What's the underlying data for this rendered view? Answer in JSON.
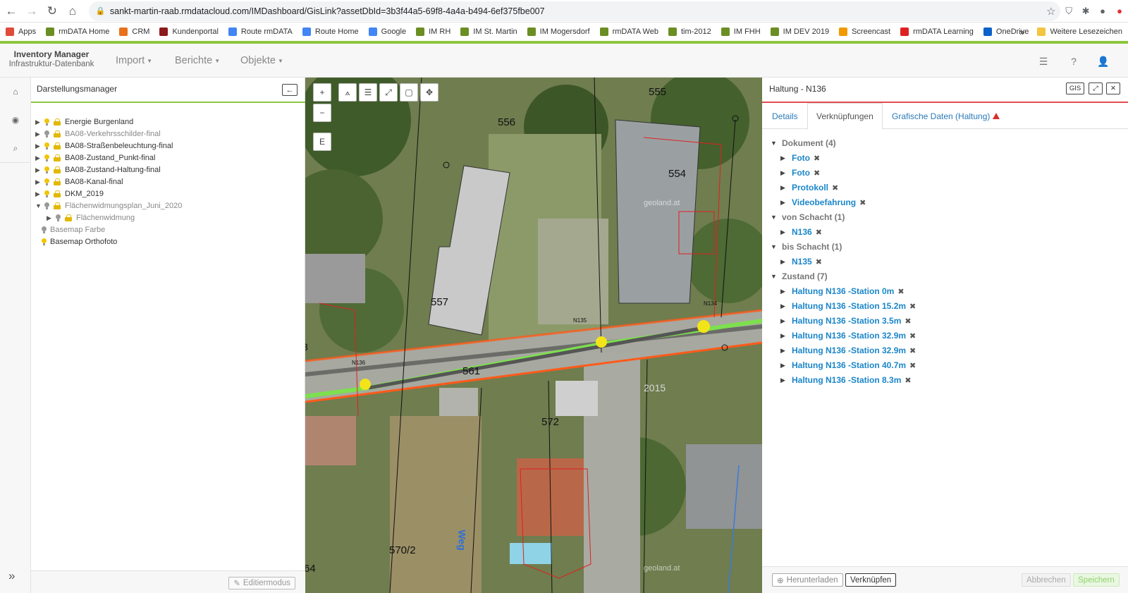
{
  "browser": {
    "url": "sankt-martin-raab.rmdatacloud.com/IMDashboard/GisLink?assetDbId=3b3f44a5-69f8-4a4a-b494-6ef375fbe007",
    "bookmarks": [
      {
        "label": "Apps",
        "color": "#e04b3a"
      },
      {
        "label": "rmDATA Home",
        "color": "#6b8e23"
      },
      {
        "label": "CRM",
        "color": "#e8711c"
      },
      {
        "label": "Kundenportal",
        "color": "#8b1a1a"
      },
      {
        "label": "Route rmDATA",
        "color": "#4285f4"
      },
      {
        "label": "Route Home",
        "color": "#4285f4"
      },
      {
        "label": "Google",
        "color": "#4285f4"
      },
      {
        "label": "IM RH",
        "color": "#6b8e23"
      },
      {
        "label": "IM St. Martin",
        "color": "#6b8e23"
      },
      {
        "label": "IM Mogersdorf",
        "color": "#6b8e23"
      },
      {
        "label": "rmDATA Web",
        "color": "#6b8e23"
      },
      {
        "label": "tim-2012",
        "color": "#6b8e23"
      },
      {
        "label": "IM FHH",
        "color": "#6b8e23"
      },
      {
        "label": "IM DEV 2019",
        "color": "#6b8e23"
      },
      {
        "label": "Screencast",
        "color": "#f29900"
      },
      {
        "label": "rmDATA Learning",
        "color": "#d22"
      },
      {
        "label": "OneDrive",
        "color": "#0b63c9"
      }
    ],
    "more_bookmarks": "»",
    "other_bookmarks": "Weitere Lesezeichen"
  },
  "app": {
    "brand_title": "Inventory Manager",
    "brand_subtitle": "Infrastruktur-Datenbank",
    "menu": [
      {
        "label": "Import"
      },
      {
        "label": "Berichte"
      },
      {
        "label": "Objekte"
      }
    ]
  },
  "layer_manager": {
    "title": "Darstellungsmanager",
    "layers": [
      {
        "label": "Energie Burgenland",
        "bulb": "on",
        "lock": true,
        "expand": "▶",
        "dim": false
      },
      {
        "label": "BA08-Verkehrsschilder-final",
        "bulb": "off",
        "lock": true,
        "expand": "▶",
        "dim": true
      },
      {
        "label": "BA08-Straßenbeleuchtung-final",
        "bulb": "on",
        "lock": true,
        "expand": "▶",
        "dim": false
      },
      {
        "label": "BA08-Zustand_Punkt-final",
        "bulb": "on",
        "lock": true,
        "expand": "▶",
        "dim": false
      },
      {
        "label": "BA08-Zustand-Haltung-final",
        "bulb": "on",
        "lock": true,
        "expand": "▶",
        "dim": false
      },
      {
        "label": "BA08-Kanal-final",
        "bulb": "on",
        "lock": true,
        "expand": "▶",
        "dim": false
      },
      {
        "label": "DKM_2019",
        "bulb": "on",
        "lock": true,
        "expand": "▶",
        "dim": false
      },
      {
        "label": "Flächenwidmungsplan_Juni_2020",
        "bulb": "off",
        "lock": true,
        "expand": "▼",
        "dim": true
      },
      {
        "label": "Flächenwidmung",
        "bulb": "off",
        "lock": true,
        "expand": "▶",
        "dim": true,
        "indent": true
      },
      {
        "label": "Basemap Farbe",
        "bulb": "off",
        "lock": false,
        "expand": "",
        "dim": true
      },
      {
        "label": "Basemap Orthofoto",
        "bulb": "on",
        "lock": false,
        "expand": "",
        "dim": false
      }
    ],
    "edit_button": "Editiermodus"
  },
  "map": {
    "parcels": [
      {
        "label": "555"
      },
      {
        "label": "556"
      },
      {
        "label": "554"
      },
      {
        "label": "557"
      },
      {
        "label": "561"
      },
      {
        "label": "572"
      },
      {
        "label": "570/2"
      },
      {
        "label": "Weg"
      },
      {
        "label": "64"
      },
      {
        "label": "3"
      },
      {
        "label": "2015"
      }
    ],
    "nodes": [
      {
        "label": "N136"
      },
      {
        "label": "N135"
      },
      {
        "label": "N134"
      }
    ],
    "watermark": "geoland.at",
    "tools": {
      "zoom_in": "+",
      "zoom_out": "−",
      "e": "E"
    }
  },
  "detail": {
    "title": "Haltung - N136",
    "gis_button": "GIS",
    "tabs": [
      {
        "label": "Details"
      },
      {
        "label": "Verknüpfungen"
      },
      {
        "label": "Grafische Daten (Haltung)"
      }
    ],
    "groups": [
      {
        "label": "Dokument (4)",
        "items": [
          "Foto",
          "Foto",
          "Protokoll",
          "Videobefahrung"
        ]
      },
      {
        "label": "von Schacht (1)",
        "items": [
          "N136"
        ]
      },
      {
        "label": "bis Schacht (1)",
        "items": [
          "N135"
        ]
      },
      {
        "label": "Zustand (7)",
        "items": [
          "Haltung N136 -Station 0m",
          "Haltung N136 -Station 15.2m",
          "Haltung N136 -Station 3.5m",
          "Haltung N136 -Station 32.9m",
          "Haltung N136 -Station 32.9m",
          "Haltung N136 -Station 40.7m",
          "Haltung N136 -Station 8.3m"
        ]
      }
    ],
    "footer": {
      "download": "Herunterladen",
      "link": "Verknüpfen",
      "cancel": "Abbrechen",
      "save": "Speichern"
    }
  }
}
